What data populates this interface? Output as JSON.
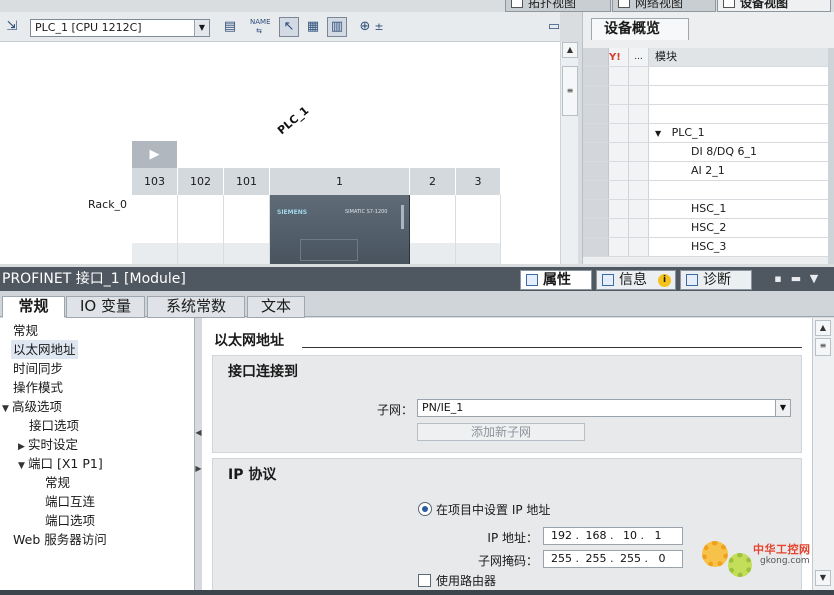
{
  "view_tabs": [
    {
      "label": "拓扑视图",
      "active": false
    },
    {
      "label": "网络视图",
      "active": false
    },
    {
      "label": "设备视图",
      "active": true
    }
  ],
  "toolbar": {
    "device_selector": "PLC_1 [CPU 1212C]",
    "icons": [
      "topology-icon",
      "device-list-icon",
      "name-icon",
      "pointer-icon",
      "grid-icon",
      "page-icon",
      "zoom-icon"
    ],
    "zoom_suffix": "±"
  },
  "canvas": {
    "plc_name": "PLC_1",
    "rack_label": "Rack_0",
    "slots": [
      "103",
      "102",
      "101",
      "1",
      "2",
      "3"
    ],
    "cpu_brand": "SIEMENS",
    "cpu_model": "SIMATIC S7-1200"
  },
  "overview": {
    "tab_label": "设备概览",
    "header": {
      "col_dots": "...",
      "col_module": "模块"
    },
    "rows": [
      {
        "module": "",
        "level": 0
      },
      {
        "module": "",
        "level": 0
      },
      {
        "module": "",
        "level": 0
      },
      {
        "module": "PLC_1",
        "level": 1,
        "expanded": true
      },
      {
        "module": "DI 8/DQ 6_1",
        "level": 2
      },
      {
        "module": "AI 2_1",
        "level": 2
      },
      {
        "module": "",
        "level": 0
      },
      {
        "module": "HSC_1",
        "level": 2
      },
      {
        "module": "HSC_2",
        "level": 2
      },
      {
        "module": "HSC_3",
        "level": 2
      }
    ]
  },
  "inspector": {
    "title": "PROFINET 接口_1 [Module]",
    "tabs": [
      {
        "label": "属性",
        "active": true
      },
      {
        "label": "信息",
        "active": false
      },
      {
        "label": "诊断",
        "active": false
      }
    ],
    "info_badge": "i",
    "sub_tabs": [
      {
        "label": "常规",
        "active": true
      },
      {
        "label": "IO 变量",
        "active": false
      },
      {
        "label": "系统常数",
        "active": false
      },
      {
        "label": "文本",
        "active": false
      }
    ],
    "nav": [
      {
        "label": "常规",
        "level": 0,
        "tri": ""
      },
      {
        "label": "以太网地址",
        "level": 0,
        "tri": "",
        "selected": true
      },
      {
        "label": "时间同步",
        "level": 0,
        "tri": ""
      },
      {
        "label": "操作模式",
        "level": 0,
        "tri": ""
      },
      {
        "label": "高级选项",
        "level": 0,
        "tri": "▼"
      },
      {
        "label": "接口选项",
        "level": 1,
        "tri": ""
      },
      {
        "label": "实时设定",
        "level": 1,
        "tri": "▶"
      },
      {
        "label": "端口 [X1 P1]",
        "level": 1,
        "tri": "▼"
      },
      {
        "label": "常规",
        "level": 2,
        "tri": ""
      },
      {
        "label": "端口互连",
        "level": 2,
        "tri": ""
      },
      {
        "label": "端口选项",
        "level": 2,
        "tri": ""
      },
      {
        "label": "Web 服务器访问",
        "level": 0,
        "tri": ""
      }
    ],
    "section_title": "以太网地址",
    "interface_group": {
      "title": "接口连接到",
      "subnet_label": "子网：",
      "subnet_value": "PN/IE_1",
      "add_subnet_button": "添加新子网"
    },
    "ip_group": {
      "title": "IP 协议",
      "radio_label": "在项目中设置 IP 地址",
      "ip_label": "IP 地址：",
      "ip": [
        "192",
        "168",
        "10",
        "1"
      ],
      "mask_label": "子网掩码：",
      "mask": [
        "255",
        "255",
        "255",
        "0"
      ],
      "router_label": "使用路由器"
    }
  },
  "watermark": {
    "line1": "中华工控网",
    "line2": "gkong.com"
  },
  "colors": {
    "title_bar": "#4f5861",
    "selection": "#dde6f1",
    "group_bg": "#e7e9eb",
    "cpu_body": "#55616c"
  }
}
